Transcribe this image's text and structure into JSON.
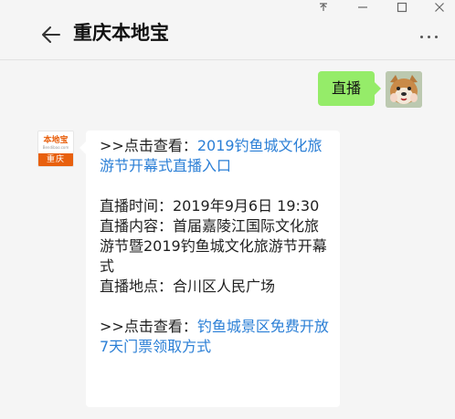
{
  "window": {
    "controls": [
      {
        "name": "pin-icon",
        "glyph": "⊼"
      },
      {
        "name": "minimize-icon",
        "glyph": "—"
      },
      {
        "name": "maximize-icon",
        "glyph": "☐"
      },
      {
        "name": "close-icon",
        "glyph": "✕"
      }
    ]
  },
  "header": {
    "title": "重庆本地宝",
    "back_icon": "arrow-left-icon",
    "more_icon": "more-icon"
  },
  "messages": {
    "outgoing": {
      "text": "直播",
      "bubble_color": "#95ec69"
    },
    "incoming": {
      "avatar": {
        "brand": "本地宝",
        "domain": "Bendibao.com",
        "city": "重庆",
        "brand_color": "#e8600e"
      },
      "line1_prefix": ">>点击查看：",
      "line1_link": "2019钓鱼城文化旅游节开幕式直播入口",
      "time_line": "直播时间：2019年9月6日  19:30",
      "content_line": "直播内容：首届嘉陵江国际文化旅游节暨2019钓鱼城文化旅游节开幕式",
      "place_line": "直播地点：合川区人民广场",
      "line2_prefix": ">>点击查看：",
      "line2_link": "钓鱼城景区免费开放7天门票领取方式",
      "link_color": "#2b7fd6"
    }
  }
}
